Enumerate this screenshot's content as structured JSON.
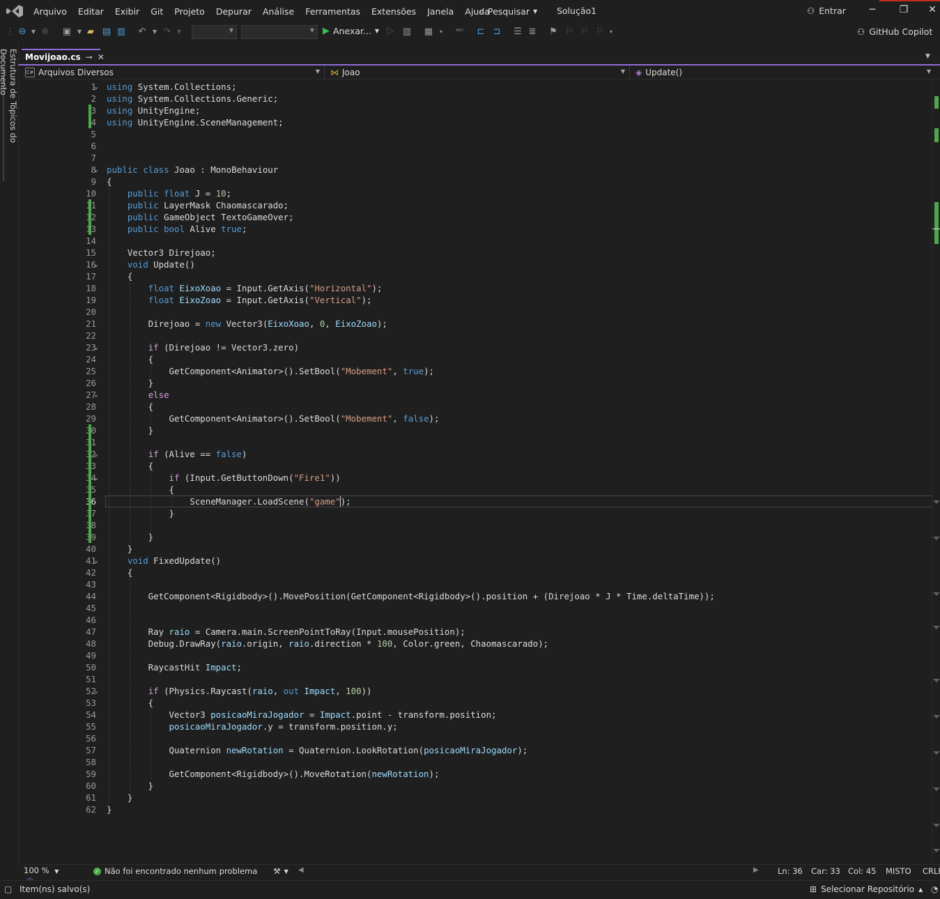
{
  "menu": {
    "items": [
      "Arquivo",
      "Editar",
      "Exibir",
      "Git",
      "Projeto",
      "Depurar",
      "Análise",
      "Ferramentas",
      "Extensões",
      "Janela",
      "Ajuda"
    ],
    "search_label": "Pesquisar",
    "solution_name": "Solução1",
    "signin_label": "Entrar"
  },
  "toolbar": {
    "attach_label": "Anexar...",
    "copilot_label": "GitHub Copilot"
  },
  "side_panel": {
    "document_outline_label": "Estrutura de Tópicos do Documento"
  },
  "tab": {
    "title": "Movijoao.cs",
    "pin_glyph": "⊸",
    "close_glyph": "✕"
  },
  "nav": {
    "project": "Arquivos Diversos",
    "class": "Joao",
    "member": "Update()"
  },
  "editor": {
    "current_line": 36,
    "lines": [
      {
        "n": 1,
        "t": "using System.Collections;"
      },
      {
        "n": 2,
        "t": "using System.Collections.Generic;"
      },
      {
        "n": 3,
        "t": "using UnityEngine;"
      },
      {
        "n": 4,
        "t": "using UnityEngine.SceneManagement;"
      },
      {
        "n": 5,
        "t": ""
      },
      {
        "n": 6,
        "t": ""
      },
      {
        "n": 7,
        "t": ""
      },
      {
        "n": 8,
        "t": "public class Joao : MonoBehaviour"
      },
      {
        "n": 9,
        "t": "{"
      },
      {
        "n": 10,
        "t": "    public float J = 10;"
      },
      {
        "n": 11,
        "t": "    public LayerMask Chaomascarado;"
      },
      {
        "n": 12,
        "t": "    public GameObject TextoGameOver;"
      },
      {
        "n": 13,
        "t": "    public bool Alive true;"
      },
      {
        "n": 14,
        "t": ""
      },
      {
        "n": 15,
        "t": "    Vector3 Direjoao;"
      },
      {
        "n": 16,
        "t": "    void Update()"
      },
      {
        "n": 17,
        "t": "    {"
      },
      {
        "n": 18,
        "t": "        float EixoXoao = Input.GetAxis(\"Horizontal\");"
      },
      {
        "n": 19,
        "t": "        float EixoZoao = Input.GetAxis(\"Vertical\");"
      },
      {
        "n": 20,
        "t": ""
      },
      {
        "n": 21,
        "t": "        Direjoao = new Vector3(EixoXoao, 0, EixoZoao);"
      },
      {
        "n": 22,
        "t": ""
      },
      {
        "n": 23,
        "t": "        if (Direjoao != Vector3.zero)"
      },
      {
        "n": 24,
        "t": "        {"
      },
      {
        "n": 25,
        "t": "            GetComponent<Animator>().SetBool(\"Mobement\", true);"
      },
      {
        "n": 26,
        "t": "        }"
      },
      {
        "n": 27,
        "t": "        else"
      },
      {
        "n": 28,
        "t": "        {"
      },
      {
        "n": 29,
        "t": "            GetComponent<Animator>().SetBool(\"Mobement\", false);"
      },
      {
        "n": 30,
        "t": "        }"
      },
      {
        "n": 31,
        "t": ""
      },
      {
        "n": 32,
        "t": "        if (Alive == false)"
      },
      {
        "n": 33,
        "t": "        {"
      },
      {
        "n": 34,
        "t": "            if (Input.GetButtonDown(\"Fire1\"))"
      },
      {
        "n": 35,
        "t": "            {"
      },
      {
        "n": 36,
        "t": "                SceneManager.LoadScene(\"game\");"
      },
      {
        "n": 37,
        "t": "            }"
      },
      {
        "n": 38,
        "t": ""
      },
      {
        "n": 39,
        "t": "        }"
      },
      {
        "n": 40,
        "t": "    }"
      },
      {
        "n": 41,
        "t": "    void FixedUpdate()"
      },
      {
        "n": 42,
        "t": "    {"
      },
      {
        "n": 43,
        "t": ""
      },
      {
        "n": 44,
        "t": "        GetComponent<Rigidbody>().MovePosition(GetComponent<Rigidbody>().position + (Direjoao * J * Time.deltaTime));"
      },
      {
        "n": 45,
        "t": ""
      },
      {
        "n": 46,
        "t": ""
      },
      {
        "n": 47,
        "t": "        Ray raio = Camera.main.ScreenPointToRay(Input.mousePosition);"
      },
      {
        "n": 48,
        "t": "        Debug.DrawRay(raio.origin, raio.direction * 100, Color.green, Chaomascarado);"
      },
      {
        "n": 49,
        "t": ""
      },
      {
        "n": 50,
        "t": "        RaycastHit Impact;"
      },
      {
        "n": 51,
        "t": ""
      },
      {
        "n": 52,
        "t": "        if (Physics.Raycast(raio, out Impact, 100))"
      },
      {
        "n": 53,
        "t": "        {"
      },
      {
        "n": 54,
        "t": "            Vector3 posicaoMiraJogador = Impact.point - transform.position;"
      },
      {
        "n": 55,
        "t": "            posicaoMiraJogador.y = transform.position.y;"
      },
      {
        "n": 56,
        "t": ""
      },
      {
        "n": 57,
        "t": "            Quaternion newRotation = Quaternion.LookRotation(posicaoMiraJogador);"
      },
      {
        "n": 58,
        "t": ""
      },
      {
        "n": 59,
        "t": "            GetComponent<Rigidbody>().MoveRotation(newRotation);"
      },
      {
        "n": 60,
        "t": "        }"
      },
      {
        "n": 61,
        "t": "    }"
      },
      {
        "n": 62,
        "t": "}"
      }
    ],
    "fold_lines": [
      1,
      8,
      16,
      23,
      27,
      32,
      34,
      41,
      52
    ],
    "changed_lines": [
      3,
      4,
      11,
      12,
      13,
      30,
      31,
      32,
      33,
      34,
      35,
      36,
      37,
      38,
      39
    ]
  },
  "editor_status": {
    "zoom": "100 %",
    "issues": "Não foi encontrado nenhum problema",
    "line": "Ln: 36",
    "char": "Car: 33",
    "col": "Col: 45",
    "whitespace": "MISTO",
    "line_ending": "CRLF"
  },
  "statusbar": {
    "message": "Item(ns) salvo(s)",
    "repo_label": "Selecionar Repositório"
  },
  "colors": {
    "keyword": "#569cd6",
    "type": "#4ec9b0",
    "string": "#d69d85",
    "number": "#b5cea8",
    "variable": "#9cdcfe",
    "control": "#d8a0df",
    "accent": "#8f6cd8",
    "change_bar": "#4caa4c"
  }
}
